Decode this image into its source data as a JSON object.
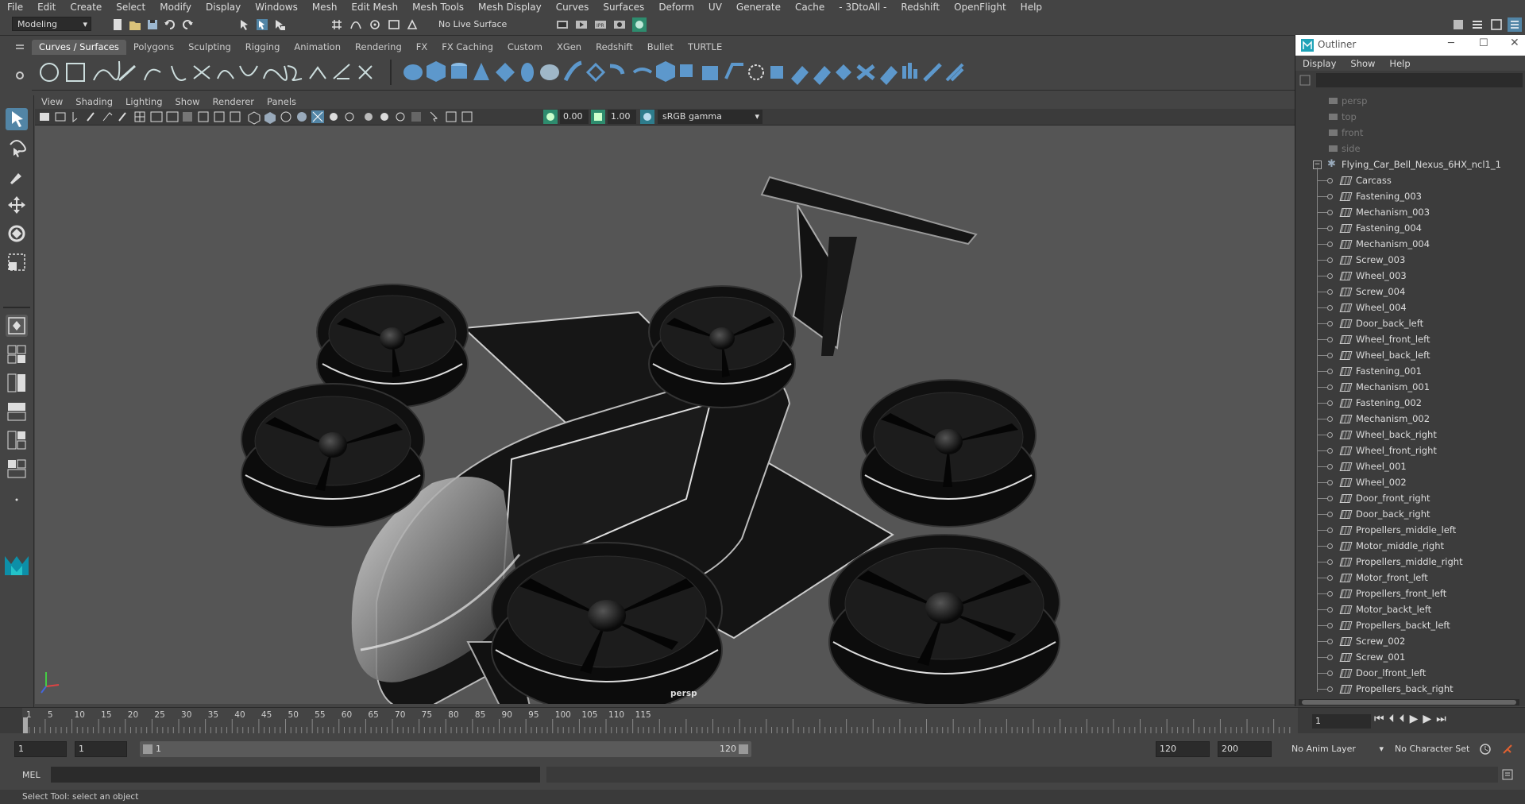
{
  "menubar": [
    "File",
    "Edit",
    "Create",
    "Select",
    "Modify",
    "Display",
    "Windows",
    "Mesh",
    "Edit Mesh",
    "Mesh Tools",
    "Mesh Display",
    "Curves",
    "Surfaces",
    "Deform",
    "UV",
    "Generate",
    "Cache",
    "- 3DtoAll -",
    "Redshift",
    "OpenFlight",
    "Help"
  ],
  "status_line": {
    "workspace": "Modeling",
    "live_surface": "No Live Surface"
  },
  "shelf_tabs": [
    "Curves / Surfaces",
    "Polygons",
    "Sculpting",
    "Rigging",
    "Animation",
    "Rendering",
    "FX",
    "FX Caching",
    "Custom",
    "XGen",
    "Redshift",
    "Bullet",
    "TURTLE"
  ],
  "shelf_active": "Curves / Surfaces",
  "viewport": {
    "menu": [
      "View",
      "Shading",
      "Lighting",
      "Show",
      "Renderer",
      "Panels"
    ],
    "exposure": "0.00",
    "gamma": "1.00",
    "color_space": "sRGB gamma",
    "camera_label": "persp"
  },
  "outliner": {
    "title": "Outliner",
    "menu": [
      "Display",
      "Show",
      "Help"
    ],
    "cameras": [
      "persp",
      "top",
      "front",
      "side"
    ],
    "group": "Flying_Car_Bell_Nexus_6HX_ncl1_1",
    "children": [
      "Carcass",
      "Fastening_003",
      "Mechanism_003",
      "Fastening_004",
      "Mechanism_004",
      "Screw_003",
      "Wheel_003",
      "Screw_004",
      "Wheel_004",
      "Door_back_left",
      "Wheel_front_left",
      "Wheel_back_left",
      "Fastening_001",
      "Mechanism_001",
      "Fastening_002",
      "Mechanism_002",
      "Wheel_back_right",
      "Wheel_front_right",
      "Wheel_001",
      "Wheel_002",
      "Door_front_right",
      "Door_back_right",
      "Propellers_middle_left",
      "Motor_middle_right",
      "Propellers_middle_right",
      "Motor_front_left",
      "Propellers_front_left",
      "Motor_backt_left",
      "Propellers_backt_left",
      "Screw_002",
      "Screw_001",
      "Door_lfront_left",
      "Propellers_back_right"
    ]
  },
  "timeline": {
    "ticks": [
      "1",
      "5",
      "10",
      "15",
      "20",
      "25",
      "30",
      "35",
      "40",
      "45",
      "50",
      "55",
      "60",
      "65",
      "70",
      "75",
      "80",
      "85",
      "90",
      "95",
      "100",
      "105",
      "110",
      "115"
    ],
    "current_frame": "1"
  },
  "range": {
    "start": "1",
    "playback_start": "1",
    "slider_start": "1",
    "slider_end": "120",
    "playback_end": "120",
    "end": "200",
    "anim_layer": "No Anim Layer",
    "character_set": "No Character Set"
  },
  "command_line": {
    "lang": "MEL"
  },
  "help_line": "Select Tool: select an object",
  "colors": {
    "ui_bg": "#444444",
    "viewport_bg": "#555555",
    "accent": "#5285a6"
  }
}
